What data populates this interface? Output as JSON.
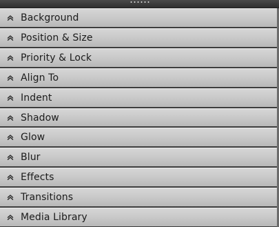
{
  "panel": {
    "sections": [
      {
        "label": "Background",
        "icon": "chevron-up-double-icon"
      },
      {
        "label": "Position & Size",
        "icon": "chevron-up-double-icon"
      },
      {
        "label": "Priority & Lock",
        "icon": "chevron-up-double-icon"
      },
      {
        "label": "Align To",
        "icon": "chevron-up-double-icon"
      },
      {
        "label": "Indent",
        "icon": "chevron-up-double-icon"
      },
      {
        "label": "Shadow",
        "icon": "chevron-up-double-icon"
      },
      {
        "label": "Glow",
        "icon": "chevron-up-double-icon"
      },
      {
        "label": "Blur",
        "icon": "chevron-up-double-icon"
      },
      {
        "label": "Effects",
        "icon": "chevron-up-double-icon"
      },
      {
        "label": "Transitions",
        "icon": "chevron-up-double-icon"
      },
      {
        "label": "Media Library",
        "icon": "chevron-up-double-icon"
      }
    ]
  }
}
